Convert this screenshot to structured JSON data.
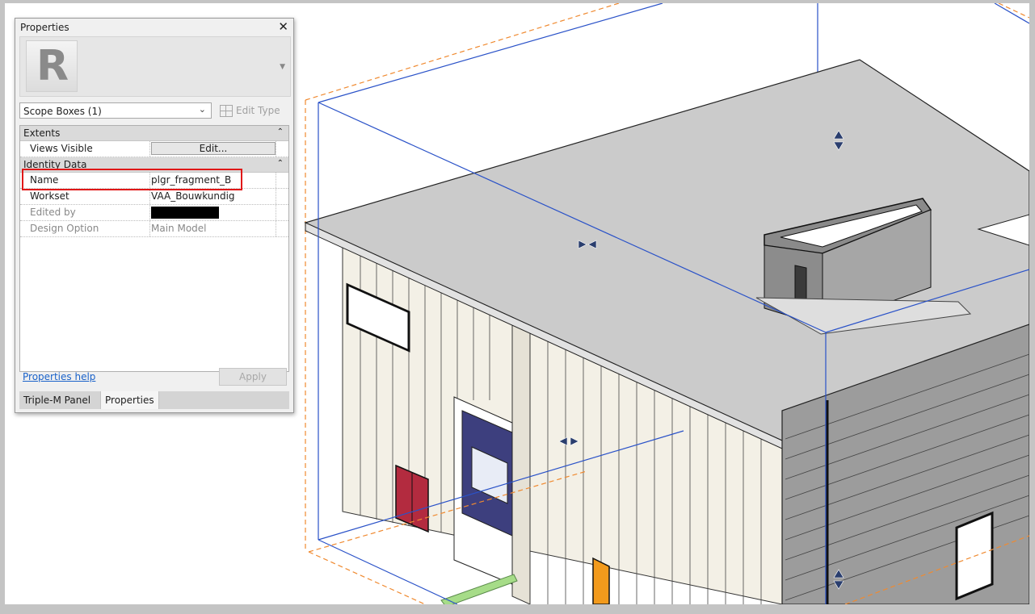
{
  "palette": {
    "roof": "#cbcbcb",
    "wall": "#f3f0e6",
    "scope_blue": "#2a52c8",
    "crop_orange": "#f08a30",
    "door_red": "#b32b3f",
    "door_orange": "#f29a1c",
    "interior_blue": "#3d3f7e",
    "pipe_green": "#a6dc88"
  },
  "properties": {
    "title": "Properties",
    "close_icon": "close-icon",
    "logo_letter": "R",
    "type_selector": {
      "value": "Scope Boxes (1)"
    },
    "edit_type_label": "Edit Type",
    "groups": [
      {
        "label": "Extents"
      },
      {
        "label": "Identity Data"
      }
    ],
    "rows": {
      "views_visible": {
        "key": "Views Visible",
        "button": "Edit..."
      },
      "name": {
        "key": "Name",
        "value": "plgr_fragment_B"
      },
      "workset": {
        "key": "Workset",
        "value": "VAA_Bouwkundig"
      },
      "edited_by": {
        "key": "Edited by"
      },
      "design_option": {
        "key": "Design Option",
        "value": "Main Model"
      }
    },
    "help_link": "Properties help",
    "apply_label": "Apply",
    "tabs": [
      "Triple-M Panel",
      "Properties"
    ]
  }
}
